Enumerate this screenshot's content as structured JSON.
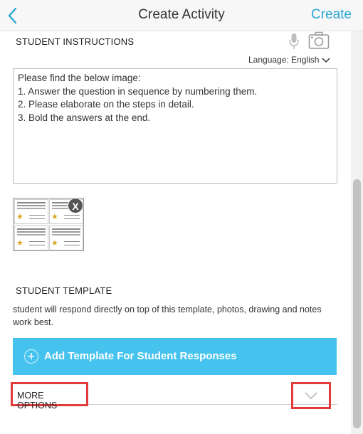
{
  "header": {
    "title": "Create Activity",
    "create_label": "Create"
  },
  "instructions": {
    "section_label": "STUDENT INSTRUCTIONS",
    "language": "Language: English",
    "lines": [
      "Please find the below image:",
      "1. Answer the question in sequence by numbering them.",
      "2. Please elaborate on the steps in detail.",
      "3. Bold the answers at the end."
    ],
    "remove_image_label": "X"
  },
  "template": {
    "section_label": "STUDENT TEMPLATE",
    "description": "student will respond directly on top of this template, photos, drawing and notes work best.",
    "add_button_label": "Add Template For Student Responses"
  },
  "more_options": {
    "label": "MORE OPTIONS"
  },
  "icons": {
    "back": "chevron-left-icon",
    "mic": "microphone-icon",
    "camera": "camera-icon",
    "language_toggle": "chevron-down-icon",
    "add": "plus-circle-icon",
    "expand": "chevron-down-icon"
  },
  "colors": {
    "accent": "#2ca6d6",
    "add_button": "#45c3ee",
    "highlight": "#e03c3c"
  }
}
